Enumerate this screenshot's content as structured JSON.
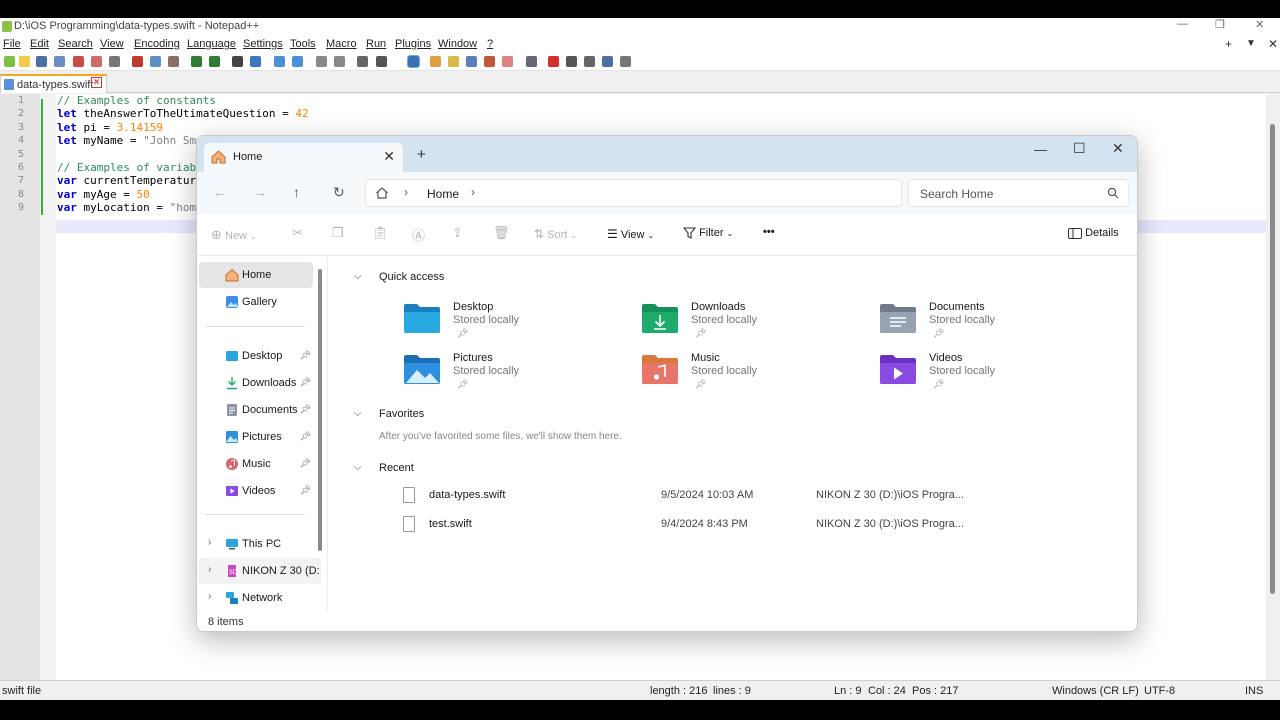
{
  "npp": {
    "title": "D:\\iOS Programming\\data-types.swift - Notepad++",
    "menu": [
      "File",
      "Edit",
      "Search",
      "View",
      "Encoding",
      "Language",
      "Settings",
      "Tools",
      "Macro",
      "Run",
      "Plugins",
      "Window",
      "?"
    ],
    "menu_right": [
      "+",
      "▼",
      "✕"
    ],
    "tab": "data-types.swift",
    "line_numbers": [
      "1",
      "2",
      "3",
      "4",
      "5",
      "6",
      "7",
      "8",
      "9"
    ],
    "code": {
      "l1": "// Examples of constants",
      "l2_kw": "let",
      "l2_rest": " theAnswerToTheUtimateQuestion = ",
      "l2_num": "42",
      "l3_kw": "let",
      "l3_rest": " pi = ",
      "l3_num": "3.14159",
      "l4_kw": "let",
      "l4_rest": " myName = ",
      "l4_str": "\"John Sm",
      "l6": "// Examples of variab",
      "l7_kw": "var",
      "l7_rest": " currentTemperatur",
      "l8_kw": "var",
      "l8_rest": " myAge = ",
      "l8_num": "50",
      "l9_kw": "var",
      "l9_rest": " myLocation = ",
      "l9_str": "\"hom"
    },
    "status": {
      "type": "swift file",
      "length": "length : 216",
      "lines": "lines : 9",
      "ln": "Ln : 9",
      "col": "Col : 24",
      "pos": "Pos : 217",
      "eol": "Windows (CR LF)",
      "encoding": "UTF-8",
      "mode": "INS"
    }
  },
  "explorer": {
    "tab_title": "Home",
    "address": {
      "crumb": "Home"
    },
    "search_placeholder": "Search Home",
    "commands": {
      "new": "New",
      "sort": "Sort",
      "view": "View",
      "filter": "Filter",
      "more": "•••",
      "details": "Details"
    },
    "sidebar": {
      "home": "Home",
      "gallery": "Gallery",
      "desktop": "Desktop",
      "downloads": "Downloads",
      "documents": "Documents",
      "pictures": "Pictures",
      "music": "Music",
      "videos": "Videos",
      "this_pc": "This PC",
      "drive": "NIKON Z 30  (D:",
      "network": "Network"
    },
    "item_count": "8 items",
    "sections": {
      "quick_access": "Quick access",
      "favorites": "Favorites",
      "recent": "Recent"
    },
    "quick_access": [
      {
        "name": "Desktop",
        "sub": "Stored locally"
      },
      {
        "name": "Downloads",
        "sub": "Stored locally"
      },
      {
        "name": "Documents",
        "sub": "Stored locally"
      },
      {
        "name": "Pictures",
        "sub": "Stored locally"
      },
      {
        "name": "Music",
        "sub": "Stored locally"
      },
      {
        "name": "Videos",
        "sub": "Stored locally"
      }
    ],
    "favorites_empty": "After you've favorited some files, we'll show them here.",
    "recent": [
      {
        "name": "data-types.swift",
        "date": "9/5/2024 10:03 AM",
        "location": "NIKON Z 30  (D:)\\iOS Progra..."
      },
      {
        "name": "test.swift",
        "date": "9/4/2024 8:43 PM",
        "location": "NIKON Z 30  (D:)\\iOS Progra..."
      }
    ],
    "colors": {
      "tabbar": "#d4e3f0",
      "nav": "#f6f9fc",
      "folder_blue": "#1e8fd6",
      "folder_green": "#1eaa6a"
    }
  }
}
